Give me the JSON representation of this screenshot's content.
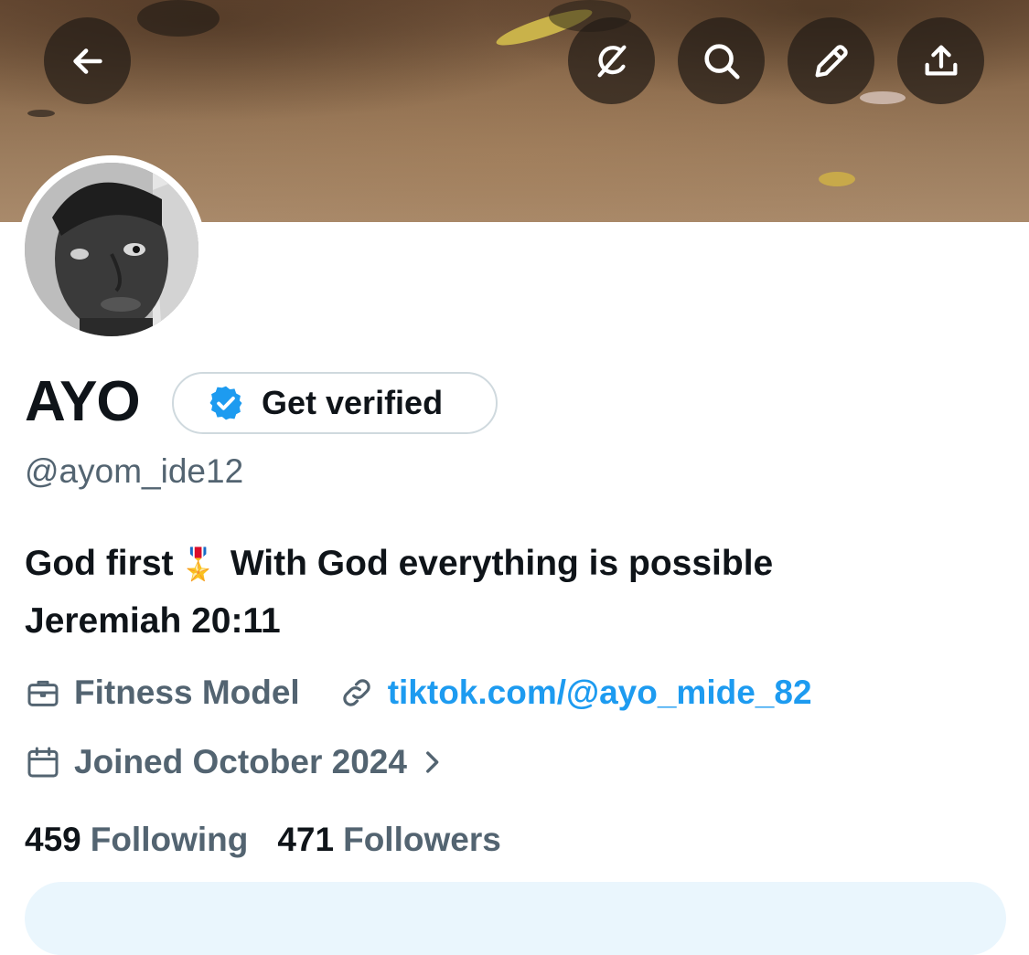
{
  "header": {
    "back_icon": "arrow-left-icon",
    "actions": [
      "grok-icon",
      "search-icon",
      "pencil-icon",
      "share-icon"
    ]
  },
  "profile": {
    "name": "AYO",
    "verify_label": "Get verified",
    "handle": "@ayom_ide12",
    "bio_line1_a": "God first",
    "bio_emoji": "🎖️",
    "bio_line1_b": "With God everything is possible",
    "bio_line2": "Jeremiah 20:11",
    "profession": "Fitness Model",
    "link": "tiktok.com/@ayo_mide_82",
    "joined": "Joined October 2024",
    "following_count": "459",
    "following_label": "Following",
    "followers_count": "471",
    "followers_label": "Followers"
  },
  "colors": {
    "accent": "#1d9bf0",
    "secondary_text": "#536471",
    "primary_text": "#0f1419"
  }
}
